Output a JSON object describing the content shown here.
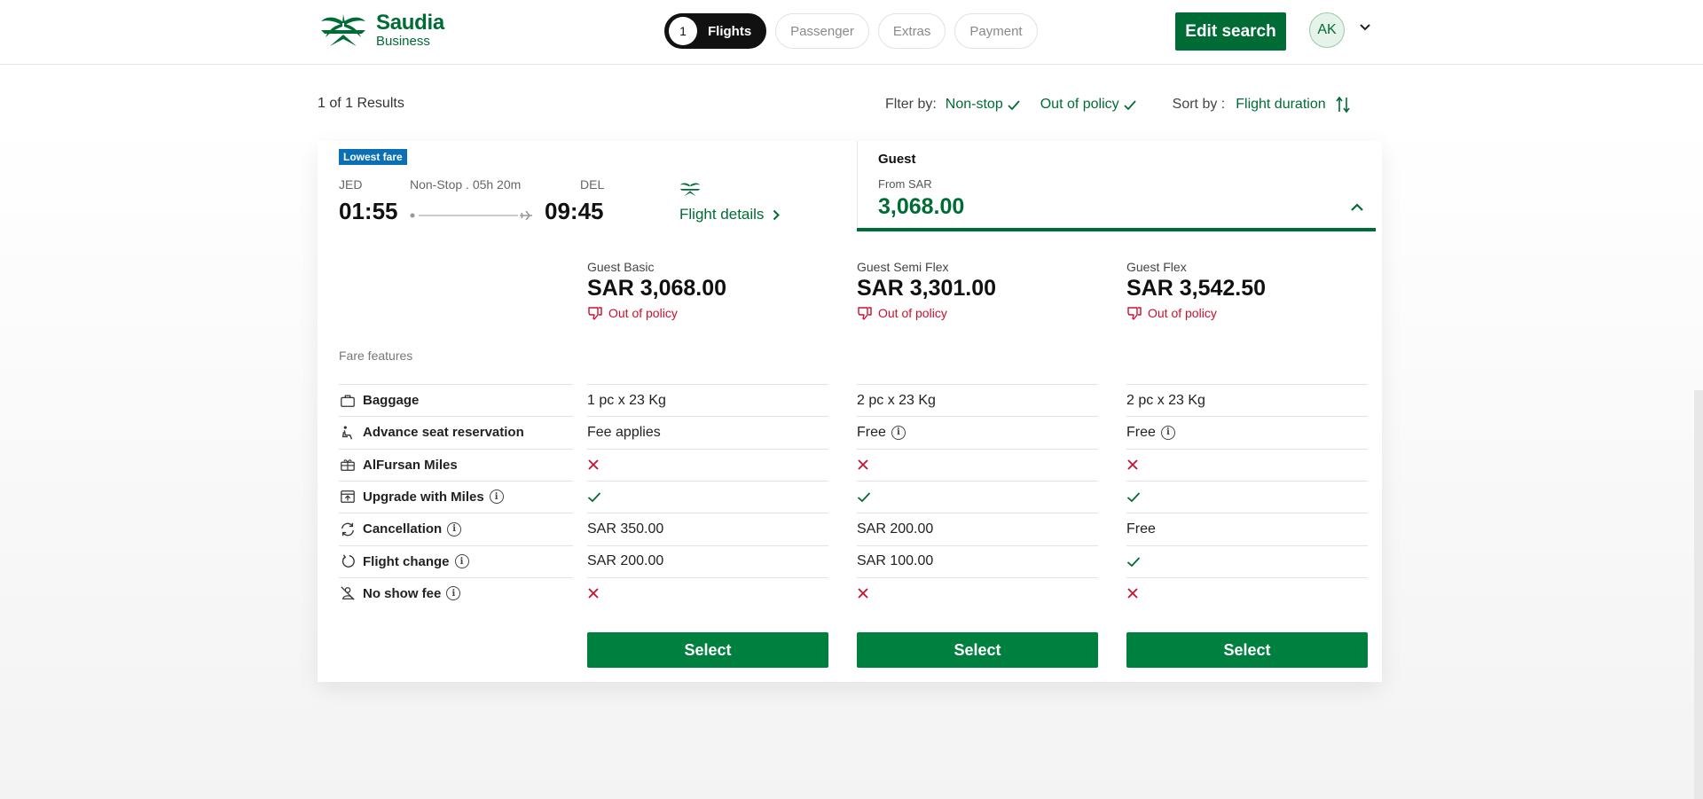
{
  "header": {
    "logo": {
      "name": "Saudia",
      "sub": "Business"
    },
    "steps": [
      {
        "num": "1",
        "label": "Flights",
        "active": true
      },
      {
        "label": "Passenger"
      },
      {
        "label": "Extras"
      },
      {
        "label": "Payment"
      }
    ],
    "edit_search_label": "Edit search",
    "avatar_initials": "AK"
  },
  "results": {
    "count_label": "1 of 1 Results",
    "filter_label": "Flter by:",
    "filters": [
      "Non-stop",
      "Out of policy"
    ],
    "sort_label": "Sort by :",
    "sort_value": "Flight duration"
  },
  "flight": {
    "badge": "Lowest fare",
    "origin": "JED",
    "destination": "DEL",
    "duration_label": "Non-Stop . 05h 20m",
    "depart_time": "01:55",
    "arrive_time": "09:45",
    "details_link": "Flight details"
  },
  "guest_panel": {
    "title": "Guest",
    "from_label": "From SAR",
    "price": "3,068.00"
  },
  "fares": [
    {
      "name": "Guest Basic",
      "price": "SAR 3,068.00",
      "policy": "Out of policy",
      "select_label": "Select"
    },
    {
      "name": "Guest Semi Flex",
      "price": "SAR 3,301.00",
      "policy": "Out of policy",
      "select_label": "Select"
    },
    {
      "name": "Guest Flex",
      "price": "SAR 3,542.50",
      "policy": "Out of policy",
      "select_label": "Select"
    }
  ],
  "fare_features_label": "Fare features",
  "features": [
    {
      "label": "Baggage",
      "icon": "baggage-icon",
      "values": [
        "1 pc x 23 Kg",
        "2 pc x 23 Kg",
        "2 pc x 23 Kg"
      ]
    },
    {
      "label": "Advance seat reservation",
      "icon": "seat-icon",
      "values": [
        "Fee applies",
        "Free",
        "Free"
      ]
    },
    {
      "label": "AlFursan Miles",
      "icon": "miles-icon",
      "values": [
        "cross",
        "cross",
        "cross"
      ]
    },
    {
      "label": "Upgrade with Miles",
      "icon": "upgrade-icon",
      "values": [
        "check",
        "check",
        "check"
      ]
    },
    {
      "label": "Cancellation",
      "icon": "cancellation-icon",
      "values": [
        "SAR 350.00",
        "SAR 200.00",
        "Free"
      ]
    },
    {
      "label": "Flight change",
      "icon": "flight-change-icon",
      "values": [
        "SAR 200.00",
        "SAR 100.00",
        "check"
      ]
    },
    {
      "label": "No show fee",
      "icon": "no-show-icon",
      "values": [
        "cross",
        "cross",
        "cross"
      ]
    }
  ],
  "colors": {
    "brand_green": "#006c35",
    "button_green": "#00803e",
    "badge_blue": "#0b6fb5",
    "policy_red": "#c8102e"
  }
}
